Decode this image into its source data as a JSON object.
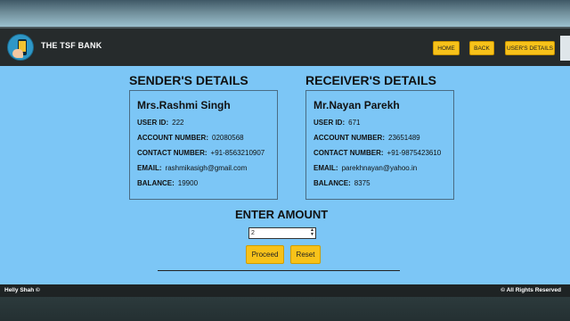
{
  "navbar": {
    "brand": "THE TSF BANK",
    "buttons": [
      "HOME",
      "BACK",
      "USER'S DETAILS"
    ]
  },
  "sender": {
    "heading": "SENDER'S DETAILS",
    "name": "Mrs.Rashmi Singh",
    "user_id_label": "USER ID:",
    "user_id": "222",
    "account_label": "ACCOUNT NUMBER:",
    "account": "02080568",
    "contact_label": "CONTACT NUMBER:",
    "contact": "+91-8563210907",
    "email_label": "EMAIL:",
    "email": "rashmikasigh@gmail.com",
    "balance_label": "BALANCE:",
    "balance": "19900"
  },
  "receiver": {
    "heading": "RECEIVER'S DETAILS",
    "name": "Mr.Nayan Parekh",
    "user_id_label": "USER ID:",
    "user_id": "671",
    "account_label": "ACCOUNT NUMBER:",
    "account": "23651489",
    "contact_label": "CONTACT NUMBER:",
    "contact": "+91-9875423610",
    "email_label": "EMAIL:",
    "email": "parekhnayan@yahoo.in",
    "balance_label": "BALANCE:",
    "balance": "8375"
  },
  "transfer": {
    "heading": "ENTER AMOUNT",
    "amount_value": "2",
    "proceed_label": "Proceed",
    "reset_label": "Reset"
  },
  "footer": {
    "left": "Helly Shah ©",
    "right": "All Rights Reserved",
    "icon": "copyright-icon"
  },
  "colors": {
    "background": "#7cc6f6",
    "navbar": "#262b2c",
    "accent": "#f7c21a"
  }
}
